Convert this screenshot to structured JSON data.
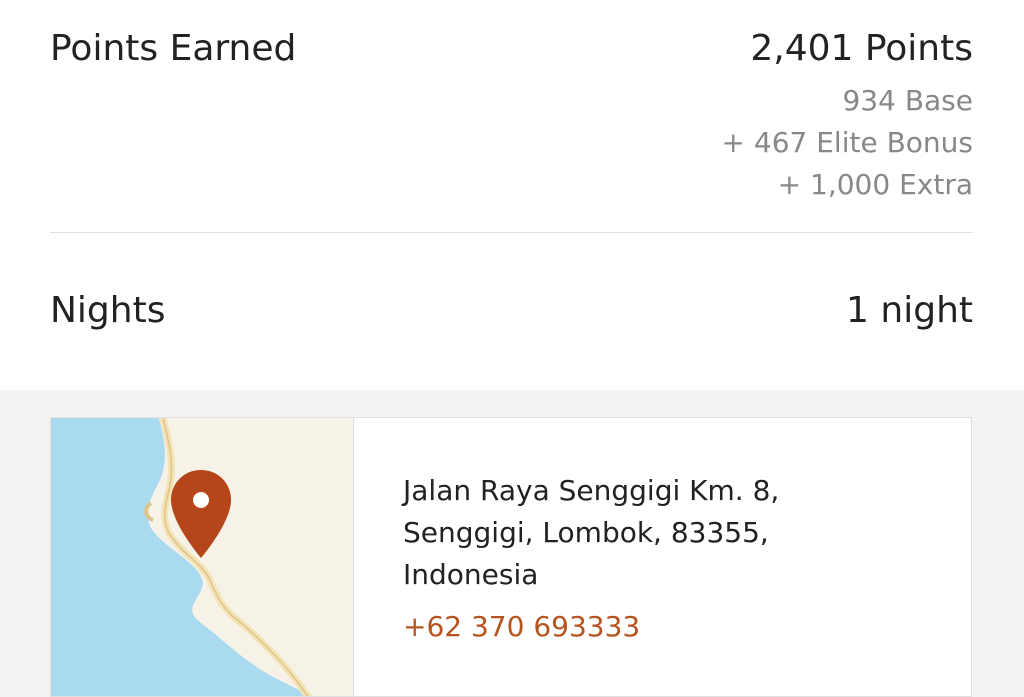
{
  "points": {
    "label": "Points Earned",
    "total": "2,401 Points",
    "breakdown": [
      "934 Base",
      "+ 467 Elite Bonus",
      "+ 1,000 Extra"
    ]
  },
  "nights": {
    "label": "Nights",
    "value": "1 night"
  },
  "location": {
    "address_lines": [
      "Jalan Raya Senggigi Km. 8,",
      "Senggigi, Lombok, 83355,",
      "Indonesia"
    ],
    "phone": "+62 370 693333",
    "map_pin_color": "#b5461a",
    "water_color": "#aadaf0",
    "land_color": "#f7f2e8"
  }
}
